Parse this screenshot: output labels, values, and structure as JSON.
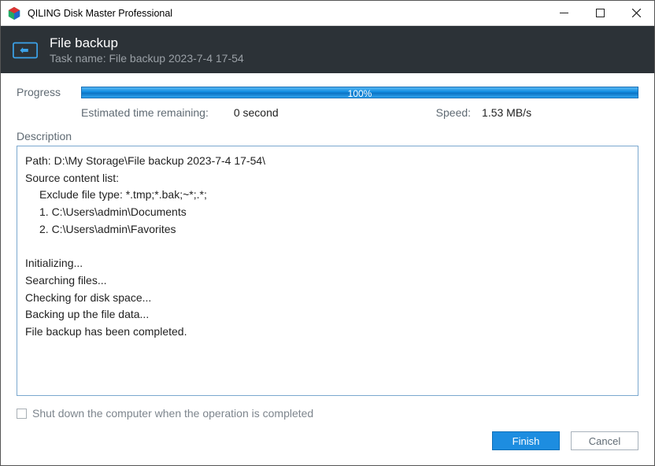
{
  "window": {
    "title": "QILING Disk Master Professional"
  },
  "header": {
    "title": "File backup",
    "subtitle": "Task name: File backup 2023-7-4 17-54"
  },
  "progress": {
    "label": "Progress",
    "percent_text": "100%",
    "eta_label": "Estimated time remaining:",
    "eta_value": "0 second",
    "speed_label": "Speed:",
    "speed_value": "1.53 MB/s"
  },
  "description": {
    "label": "Description",
    "lines": {
      "path": "Path: D:\\My Storage\\File backup 2023-7-4 17-54\\",
      "source_header": "Source content list:",
      "exclude": "Exclude file type: *.tmp;*.bak;~*;.*;",
      "src1": "1. C:\\Users\\admin\\Documents",
      "src2": "2. C:\\Users\\admin\\Favorites",
      "init": "Initializing...",
      "search": "Searching files...",
      "check": "Checking for disk space...",
      "backing": "Backing up the file data...",
      "done": "File backup has been completed."
    }
  },
  "checkbox": {
    "label": "Shut down the computer when the operation is completed"
  },
  "buttons": {
    "finish": "Finish",
    "cancel": "Cancel"
  }
}
